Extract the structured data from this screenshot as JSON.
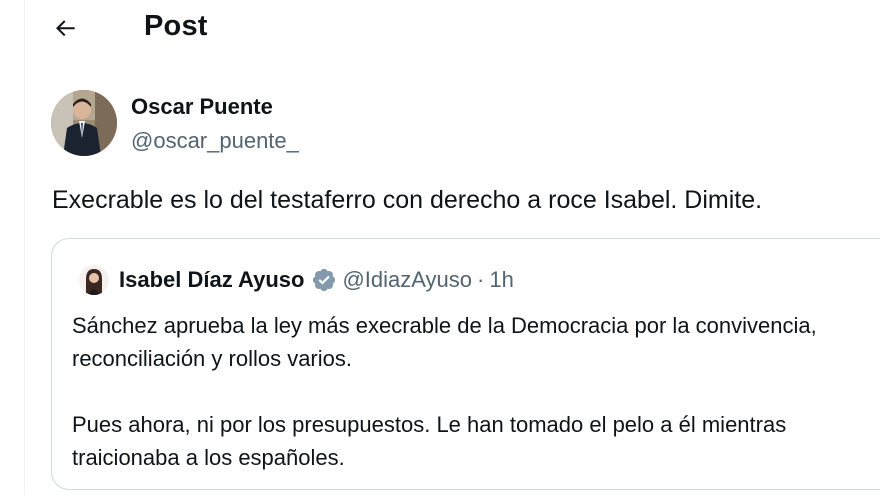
{
  "header": {
    "title": "Post"
  },
  "icons": {
    "back": "arrow-left-icon",
    "verified": "verified-badge-icon"
  },
  "colors": {
    "text": "#0f1419",
    "secondary": "#536471",
    "border": "#cfd9de",
    "verified": "#829aab"
  },
  "post": {
    "author_name": "Oscar Puente",
    "author_handle": "@oscar_puente_",
    "text": "Execrable es lo del testaferro con derecho a roce Isabel. Dimite."
  },
  "quote": {
    "author_name": "Isabel Díaz Ayuso",
    "author_handle": "@IdiazAyuso",
    "separator": "·",
    "time": "1h",
    "lines": [
      "Sánchez aprueba la ley más execrable de la Democracia por la convivencia,",
      "reconciliación y rollos varios.",
      "Pues ahora, ni por los presupuestos. Le han tomado el pelo a él mientras",
      "traicionaba a los españoles."
    ]
  }
}
